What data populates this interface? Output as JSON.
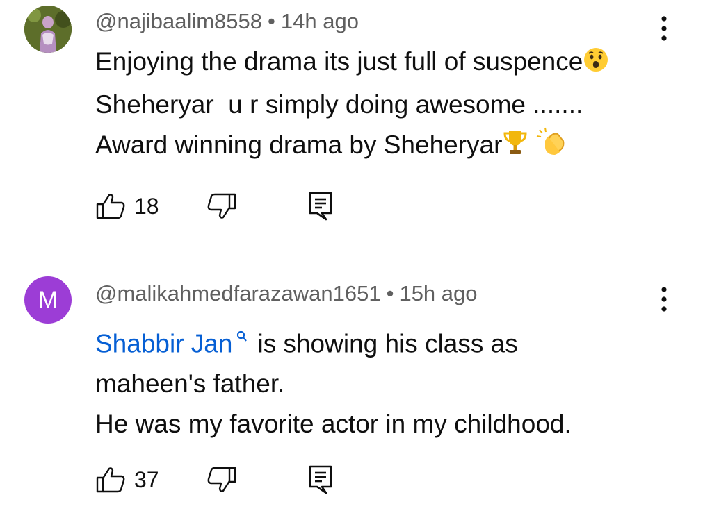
{
  "comments": [
    {
      "author": "@najibaalim8558",
      "separator": "•",
      "time": "14h ago",
      "lines": [
        "Enjoying the drama its just full of suspence",
        "Sheheryar  u r simply doing awesome .......",
        "Award winning drama by Sheheryar"
      ],
      "likes": "18",
      "avatar": {
        "type": "photo"
      },
      "emojis": [
        "astonished-face-emoji",
        "trophy-emoji",
        "clapping-hands-emoji"
      ]
    },
    {
      "author": "@malikahmedfarazawan1651",
      "separator": "•",
      "time": "15h ago",
      "mention": "Shabbir Jan",
      "lines": [
        "is showing his class as",
        "maheen's father.",
        "He was my favorite actor in my childhood."
      ],
      "likes": "37",
      "avatar": {
        "type": "letter",
        "letter": "M",
        "color": "#9c3dd6"
      }
    }
  ],
  "colors": {
    "text": "#0f0f0f",
    "meta": "#606060",
    "mention": "#065fd4"
  }
}
